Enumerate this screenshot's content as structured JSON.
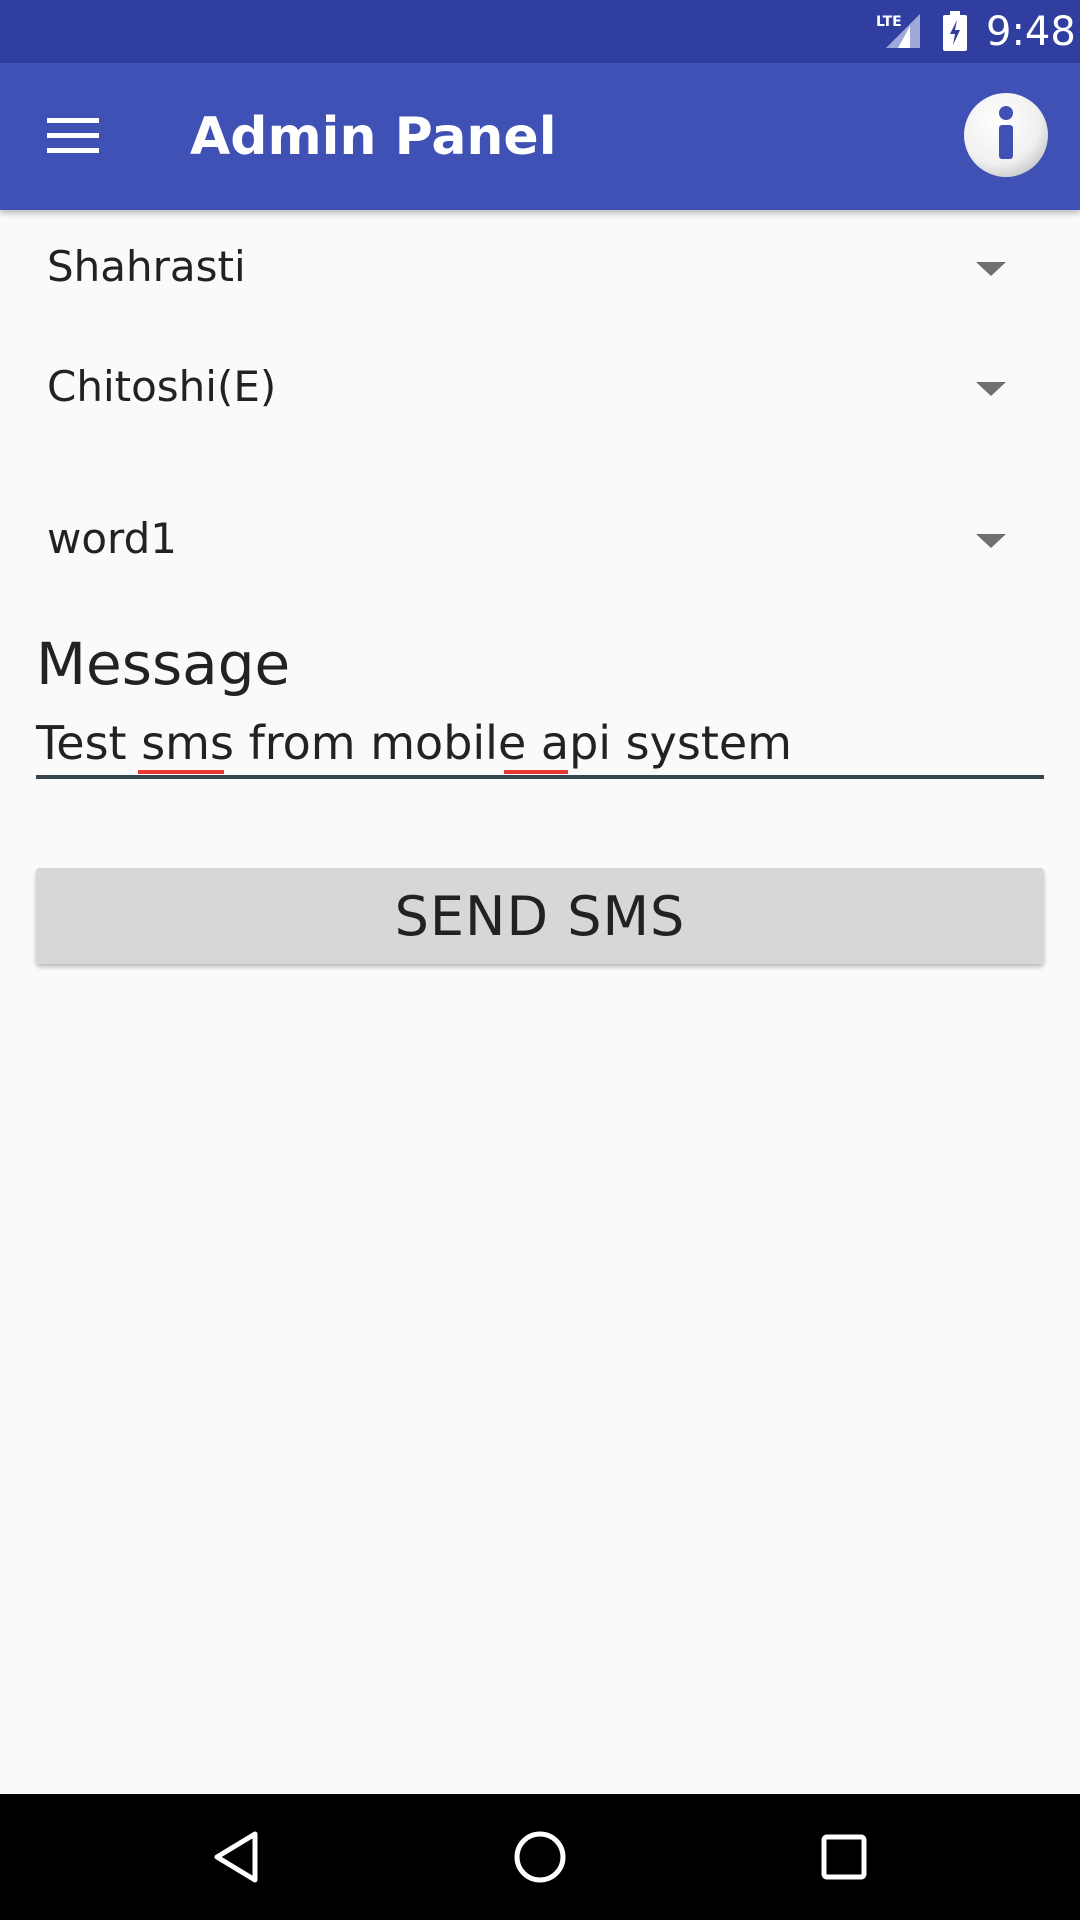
{
  "status_bar": {
    "network_label": "LTE",
    "time": "9:48",
    "icons": [
      "lte-signal-icon",
      "battery-charging-icon"
    ]
  },
  "app_bar": {
    "title": "Admin Panel",
    "menu_icon": "hamburger-menu-icon",
    "info_icon": "info-icon",
    "color": "#3f51b5",
    "status_color": "#303f9f"
  },
  "form": {
    "spinners": [
      {
        "selected": "Shahrasti"
      },
      {
        "selected": "Chitoshi(E)"
      },
      {
        "selected": "word1"
      }
    ],
    "message": {
      "label": "Message",
      "value": "Test sms from mobile api system"
    },
    "send_button_label": "SEND SMS"
  },
  "nav_bar": {
    "icons": [
      "back-icon",
      "home-icon",
      "recents-icon"
    ]
  }
}
